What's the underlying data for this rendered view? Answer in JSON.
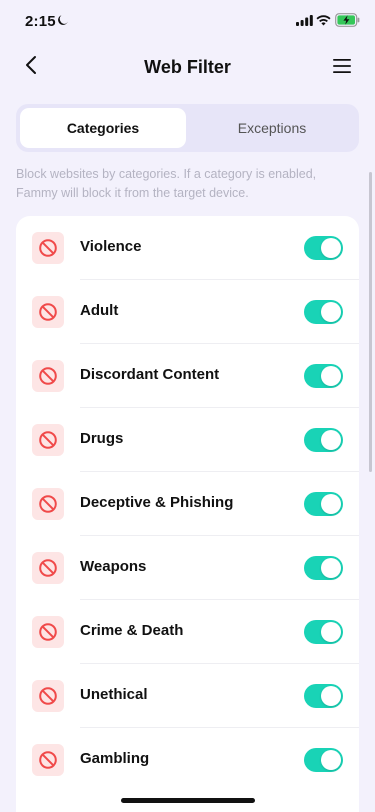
{
  "status_bar": {
    "time": "2:15"
  },
  "nav": {
    "title": "Web Filter"
  },
  "tabs": [
    {
      "label": "Categories",
      "active": true
    },
    {
      "label": "Exceptions",
      "active": false
    }
  ],
  "description": "Block websites by categories. If a category is enabled, Fammy will block it from the target device.",
  "categories": [
    {
      "label": "Violence",
      "enabled": true
    },
    {
      "label": "Adult",
      "enabled": true
    },
    {
      "label": "Discordant Content",
      "enabled": true
    },
    {
      "label": "Drugs",
      "enabled": true
    },
    {
      "label": "Deceptive & Phishing",
      "enabled": true
    },
    {
      "label": "Weapons",
      "enabled": true
    },
    {
      "label": "Crime & Death",
      "enabled": true
    },
    {
      "label": "Unethical",
      "enabled": true
    },
    {
      "label": "Gambling",
      "enabled": true
    }
  ],
  "colors": {
    "background": "#f3f1fc",
    "toggle_on": "#19d3b6",
    "block_icon": "#f04a4a",
    "block_icon_bg": "#fde5e5"
  },
  "icons": {
    "status": [
      "moon-icon",
      "signal-icon",
      "wifi-icon",
      "battery-charging-icon"
    ],
    "nav": [
      "back-icon",
      "menu-icon"
    ],
    "category": "block-icon"
  }
}
